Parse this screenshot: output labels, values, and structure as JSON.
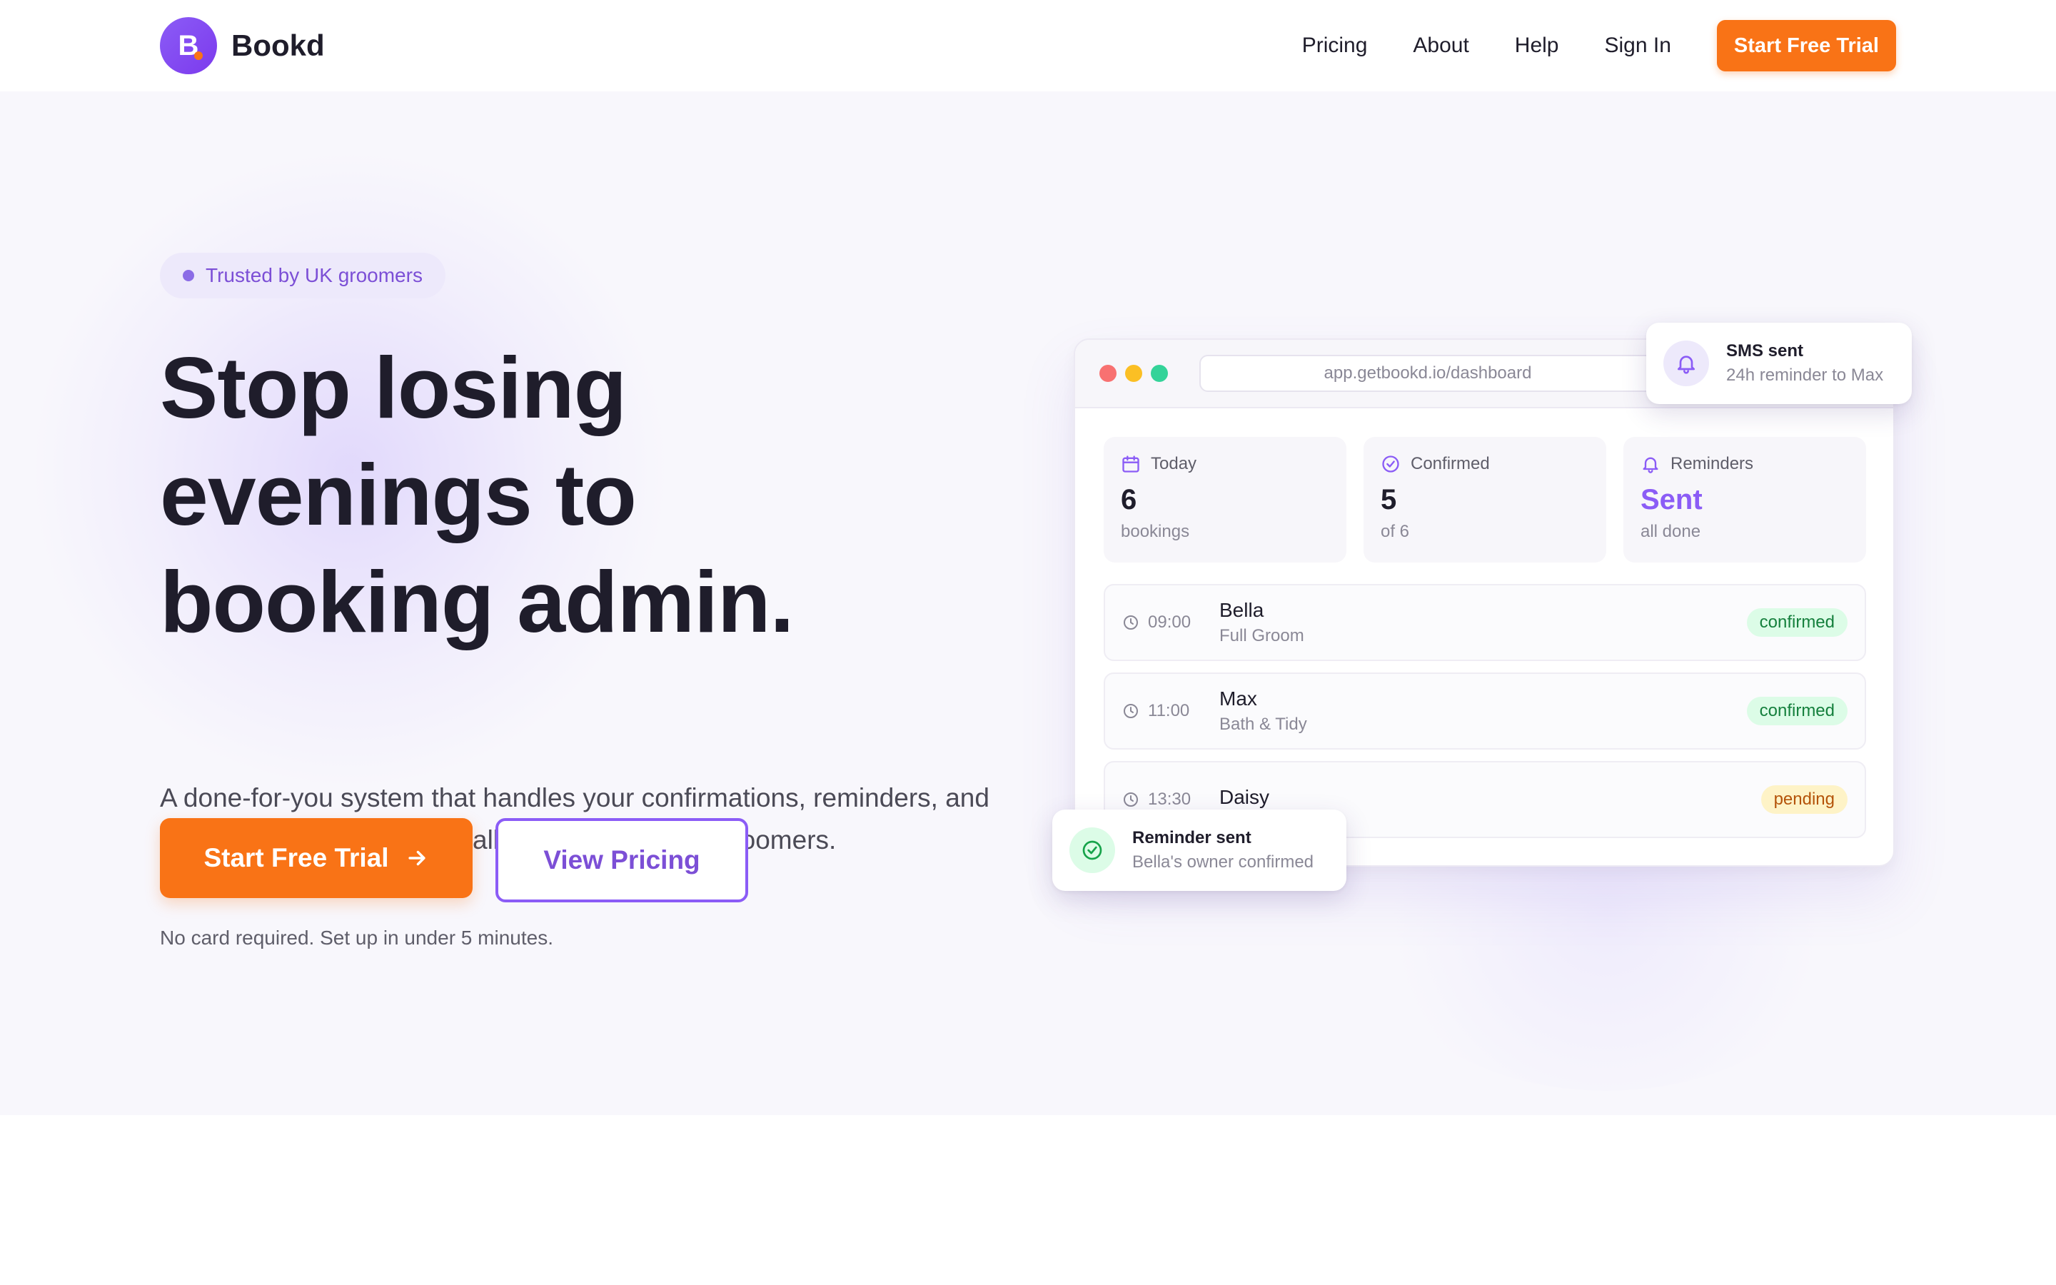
{
  "nav": {
    "logo_letter": "B",
    "brand": "Bookd",
    "links": [
      "Pricing",
      "About",
      "Help",
      "Sign In"
    ],
    "cta": "Start Free Trial"
  },
  "hero": {
    "badge": "Trusted by UK groomers",
    "headline_lines": [
      "Stop losing",
      "evenings to",
      "booking admin."
    ],
    "subtext": "A done-for-you system that handles your confirmations, reminders, and client records — automatically. Built for UK dog groomers.",
    "primary_cta": "Start Free Trial",
    "secondary_cta": "View Pricing",
    "note": "No card required. Set up in under 5 minutes."
  },
  "dashboard": {
    "url": "app.getbookd.io/dashboard",
    "stats": [
      {
        "label": "Today",
        "value": "6",
        "sub": "bookings",
        "icon": "calendar-icon"
      },
      {
        "label": "Confirmed",
        "value": "5",
        "sub": "of 6",
        "icon": "check-circle-icon"
      },
      {
        "label": "Reminders",
        "value": "Sent",
        "sub": "all done",
        "icon": "bell-icon"
      }
    ],
    "bookings": [
      {
        "time": "09:00",
        "name": "Bella",
        "service": "Full Groom",
        "status": "confirmed"
      },
      {
        "time": "11:00",
        "name": "Max",
        "service": "Bath & Tidy",
        "status": "confirmed"
      },
      {
        "time": "13:30",
        "name": "Daisy",
        "service": "",
        "status": "pending"
      }
    ]
  },
  "toasts": {
    "sms": {
      "title": "SMS sent",
      "sub": "24h reminder to Max",
      "icon": "bell-icon"
    },
    "reminder": {
      "title": "Reminder sent",
      "sub": "Bella's owner confirmed",
      "icon": "check-circle-icon"
    }
  },
  "colors": {
    "accent": "#8b5cf6",
    "cta": "#f97316",
    "confirmed": "#15803d",
    "pending": "#b45309"
  },
  "next_section": {
    "heading": ""
  }
}
